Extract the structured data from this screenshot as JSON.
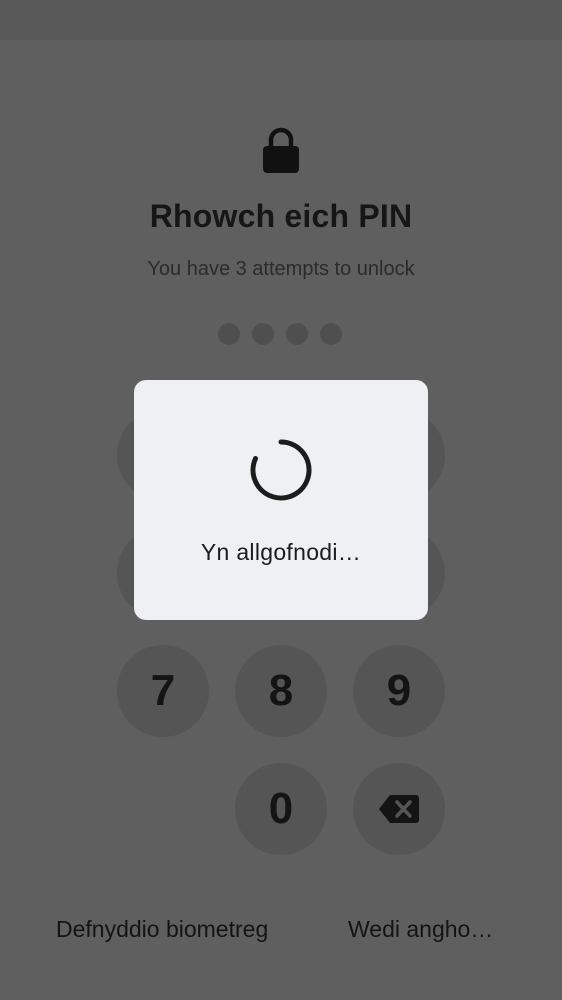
{
  "lock_screen": {
    "title": "Rhowch eich PIN",
    "subtitle": "You have 3 attempts to unlock",
    "pin_dots_count": 4,
    "keypad": {
      "visible_keys": [
        "7",
        "8",
        "9",
        "0"
      ],
      "backspace_icon": "backspace-icon"
    },
    "biometric_link": "Defnyddio biometreg",
    "forgot_link": "Wedi angho…"
  },
  "dialog": {
    "message": "Yn allgofnodi…",
    "icon": "loading-spinner-icon"
  },
  "colors": {
    "dimmed_background": "#5f5f5f",
    "dialog_background": "#eff0f4",
    "key_background": "#555555",
    "text_dark": "#161616"
  }
}
